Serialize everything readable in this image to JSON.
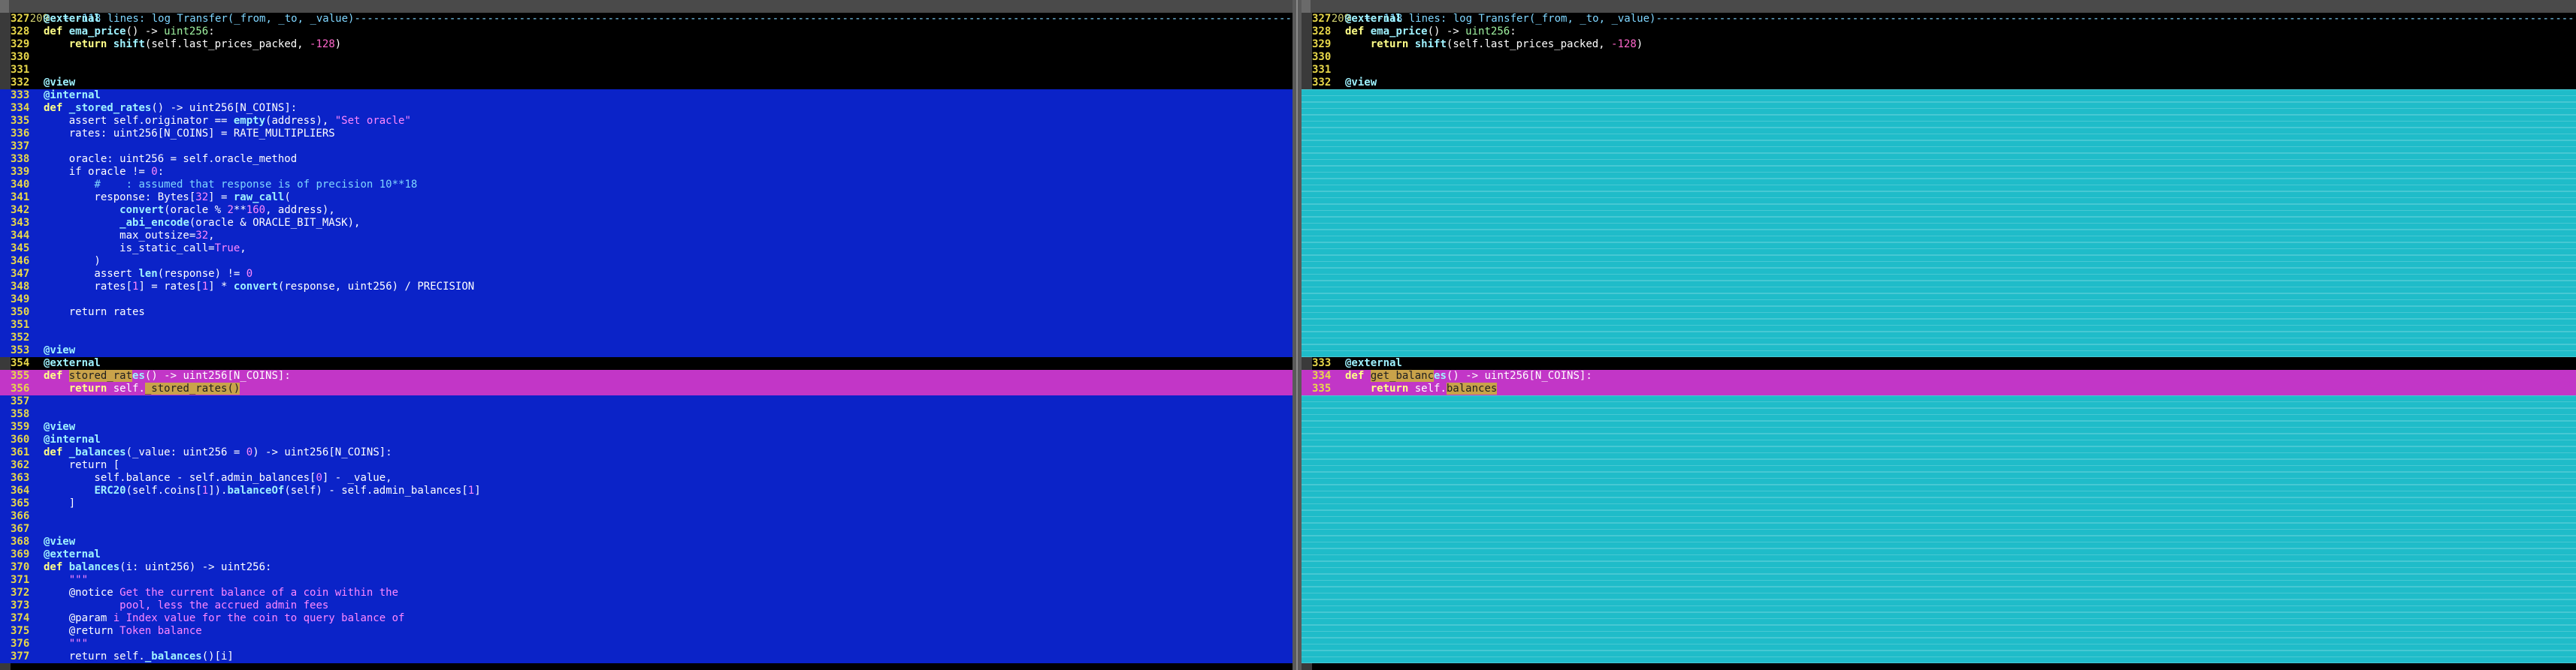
{
  "left": {
    "fold": {
      "gutter": "209",
      "text": "+--118 lines: log Transfer(_from, _to, _value)-----------------------------------------------------------------------------------------------------------------------------------------------------------------------------------------------------------"
    },
    "lines": [
      {
        "n": "327",
        "bg": "black",
        "html": "<span class='dec'>@external</span>"
      },
      {
        "n": "328",
        "bg": "black",
        "html": "<span class='kw'>def</span> <span class='fn'>ema_price</span>() -&gt; <span class='ty'>uint256</span>:"
      },
      {
        "n": "329",
        "bg": "black",
        "html": "    <span class='kw'>return</span> <span class='fn'>shift</span>(self.last_prices_packed, <span class='num'>-128</span>)"
      },
      {
        "n": "330",
        "bg": "black",
        "html": ""
      },
      {
        "n": "331",
        "bg": "black",
        "html": ""
      },
      {
        "n": "332",
        "bg": "black",
        "html": "<span class='dec'>@view</span>"
      },
      {
        "n": "333",
        "bg": "blue",
        "html": "<span class='dec'>@internal</span>"
      },
      {
        "n": "334",
        "bg": "blue",
        "html": "<span class='kw'>def</span> <span class='fn'>_stored_rates</span>() -&gt; uint256[N_COINS]:"
      },
      {
        "n": "335",
        "bg": "blue",
        "html": "    assert self.originator == <span class='fn'>empty</span>(address), <span class='str'>\"Set oracle\"</span>"
      },
      {
        "n": "336",
        "bg": "blue",
        "html": "    rates: uint256[N_COINS] = RATE_MULTIPLIERS"
      },
      {
        "n": "337",
        "bg": "blue",
        "html": ""
      },
      {
        "n": "338",
        "bg": "blue",
        "html": "    oracle: uint256 = self.oracle_method"
      },
      {
        "n": "339",
        "bg": "blue",
        "html": "    if oracle != <span class='num'>0</span>:"
      },
      {
        "n": "340",
        "bg": "blue",
        "html": "        <span class='cm'>#    : assumed that response is of precision 10**18</span>"
      },
      {
        "n": "341",
        "bg": "blue",
        "html": "        response: Bytes[<span class='num'>32</span>] = <span class='fn'>raw_call</span>("
      },
      {
        "n": "342",
        "bg": "blue",
        "html": "            <span class='fn'>convert</span>(oracle % <span class='num'>2</span>**<span class='num'>160</span>, address),"
      },
      {
        "n": "343",
        "bg": "blue",
        "html": "            <span class='fn'>_abi_encode</span>(oracle &amp; ORACLE_BIT_MASK),"
      },
      {
        "n": "344",
        "bg": "blue",
        "html": "            max_outsize=<span class='num'>32</span>,"
      },
      {
        "n": "345",
        "bg": "blue",
        "html": "            is_static_call=<span class='num'>True</span>,"
      },
      {
        "n": "346",
        "bg": "blue",
        "html": "        )"
      },
      {
        "n": "347",
        "bg": "blue",
        "html": "        assert <span class='fn'>len</span>(response) != <span class='num'>0</span>"
      },
      {
        "n": "348",
        "bg": "blue",
        "html": "        rates[<span class='num'>1</span>] = rates[<span class='num'>1</span>] * <span class='fn'>convert</span>(response, uint256) / PRECISION"
      },
      {
        "n": "349",
        "bg": "blue",
        "html": ""
      },
      {
        "n": "350",
        "bg": "blue",
        "html": "    return rates"
      },
      {
        "n": "351",
        "bg": "blue",
        "html": ""
      },
      {
        "n": "352",
        "bg": "blue",
        "html": ""
      },
      {
        "n": "353",
        "bg": "blue",
        "html": "<span class='dec'>@view</span>"
      },
      {
        "n": "354",
        "bg": "black",
        "html": "<span class='dec'>@external</span>"
      },
      {
        "n": "355",
        "bg": "mag",
        "html": "<span class='kw'>def</span> <span class='hl'>stored_rat</span><span class='fn'>es</span>() -&gt; uint256[N_COINS]:"
      },
      {
        "n": "356",
        "bg": "mag",
        "html": "    <span class='kw'>return</span> self.<span class='hl'>_stored_rates()</span>"
      },
      {
        "n": "357",
        "bg": "blue",
        "html": ""
      },
      {
        "n": "358",
        "bg": "blue",
        "html": ""
      },
      {
        "n": "359",
        "bg": "blue",
        "html": "<span class='dec'>@view</span>"
      },
      {
        "n": "360",
        "bg": "blue",
        "html": "<span class='dec'>@internal</span>"
      },
      {
        "n": "361",
        "bg": "blue",
        "html": "<span class='kw'>def</span> <span class='fn'>_balances</span>(_value: uint256 = <span class='num'>0</span>) -&gt; uint256[N_COINS]:"
      },
      {
        "n": "362",
        "bg": "blue",
        "html": "    return ["
      },
      {
        "n": "363",
        "bg": "blue",
        "html": "        self.balance - self.admin_balances[<span class='num'>0</span>] - _value,"
      },
      {
        "n": "364",
        "bg": "blue",
        "html": "        <span class='fn'>ERC20</span>(self.coins[<span class='num'>1</span>]).<span class='fn'>balanceOf</span>(self) - self.admin_balances[<span class='num'>1</span>]"
      },
      {
        "n": "365",
        "bg": "blue",
        "html": "    ]"
      },
      {
        "n": "366",
        "bg": "blue",
        "html": ""
      },
      {
        "n": "367",
        "bg": "blue",
        "html": ""
      },
      {
        "n": "368",
        "bg": "blue",
        "html": "<span class='dec'>@view</span>"
      },
      {
        "n": "369",
        "bg": "blue",
        "html": "<span class='dec'>@external</span>"
      },
      {
        "n": "370",
        "bg": "blue",
        "html": "<span class='kw'>def</span> <span class='fn'>balances</span>(i: uint256) -&gt; uint256:"
      },
      {
        "n": "371",
        "bg": "blue",
        "html": "    <span class='str'>\"\"\"</span>"
      },
      {
        "n": "372",
        "bg": "blue",
        "html": "    @notice <span class='str'>Get the current balance of a coin within the</span>"
      },
      {
        "n": "373",
        "bg": "blue",
        "html": "            <span class='str'>pool, less the accrued admin fees</span>"
      },
      {
        "n": "374",
        "bg": "blue",
        "html": "    @param <span class='str'>i Index value for the coin to query balance of</span>"
      },
      {
        "n": "375",
        "bg": "blue",
        "html": "    @return <span class='str'>Token balance</span>"
      },
      {
        "n": "376",
        "bg": "blue",
        "html": "    <span class='str'>\"\"\"</span>"
      },
      {
        "n": "377",
        "bg": "blue",
        "html": "    return self.<span class='fn'>_balances</span>()[i]"
      }
    ]
  },
  "right": {
    "fold": {
      "gutter": "209",
      "text": "+--118 lines: log Transfer(_from, _to, _value)-----------------------------------------------------------------------------------------------------------------------------------------------------------------------------------------------------------"
    },
    "lines": [
      {
        "n": "327",
        "bg": "black",
        "html": "<span class='dec'>@external</span>"
      },
      {
        "n": "328",
        "bg": "black",
        "html": "<span class='kw'>def</span> <span class='fn'>ema_price</span>() -&gt; <span class='ty'>uint256</span>:"
      },
      {
        "n": "329",
        "bg": "black",
        "html": "    <span class='kw'>return</span> <span class='fn'>shift</span>(self.last_prices_packed, <span class='num'>-128</span>)"
      },
      {
        "n": "330",
        "bg": "black",
        "html": ""
      },
      {
        "n": "331",
        "bg": "black",
        "html": ""
      },
      {
        "n": "332",
        "bg": "black",
        "html": "<span class='dec'>@view</span>"
      },
      {
        "n": "",
        "bg": "cyan",
        "html": ""
      },
      {
        "n": "",
        "bg": "cyan",
        "html": ""
      },
      {
        "n": "",
        "bg": "cyan",
        "html": ""
      },
      {
        "n": "",
        "bg": "cyan",
        "html": ""
      },
      {
        "n": "",
        "bg": "cyan",
        "html": ""
      },
      {
        "n": "",
        "bg": "cyan",
        "html": ""
      },
      {
        "n": "",
        "bg": "cyan",
        "html": ""
      },
      {
        "n": "",
        "bg": "cyan",
        "html": ""
      },
      {
        "n": "",
        "bg": "cyan",
        "html": ""
      },
      {
        "n": "",
        "bg": "cyan",
        "html": ""
      },
      {
        "n": "",
        "bg": "cyan",
        "html": ""
      },
      {
        "n": "",
        "bg": "cyan",
        "html": ""
      },
      {
        "n": "",
        "bg": "cyan",
        "html": ""
      },
      {
        "n": "",
        "bg": "cyan",
        "html": ""
      },
      {
        "n": "",
        "bg": "cyan",
        "html": ""
      },
      {
        "n": "",
        "bg": "cyan",
        "html": ""
      },
      {
        "n": "",
        "bg": "cyan",
        "html": ""
      },
      {
        "n": "",
        "bg": "cyan",
        "html": ""
      },
      {
        "n": "",
        "bg": "cyan",
        "html": ""
      },
      {
        "n": "",
        "bg": "cyan",
        "html": ""
      },
      {
        "n": "",
        "bg": "cyan",
        "html": ""
      },
      {
        "n": "333",
        "bg": "black",
        "html": "<span class='dec'>@external</span>"
      },
      {
        "n": "334",
        "bg": "mag",
        "html": "<span class='kw'>def</span> <span class='hl'>get_balanc</span><span class='fn'>es</span>() -&gt; uint256[N_COINS]:"
      },
      {
        "n": "335",
        "bg": "mag",
        "html": "    <span class='kw'>return</span> self.<span class='hl'>balances</span>"
      },
      {
        "n": "",
        "bg": "cyan",
        "html": ""
      },
      {
        "n": "",
        "bg": "cyan",
        "html": ""
      },
      {
        "n": "",
        "bg": "cyan",
        "html": ""
      },
      {
        "n": "",
        "bg": "cyan",
        "html": ""
      },
      {
        "n": "",
        "bg": "cyan",
        "html": ""
      },
      {
        "n": "",
        "bg": "cyan",
        "html": ""
      },
      {
        "n": "",
        "bg": "cyan",
        "html": ""
      },
      {
        "n": "",
        "bg": "cyan",
        "html": ""
      },
      {
        "n": "",
        "bg": "cyan",
        "html": ""
      },
      {
        "n": "",
        "bg": "cyan",
        "html": ""
      },
      {
        "n": "",
        "bg": "cyan",
        "html": ""
      },
      {
        "n": "",
        "bg": "cyan",
        "html": ""
      },
      {
        "n": "",
        "bg": "cyan",
        "html": ""
      },
      {
        "n": "",
        "bg": "cyan",
        "html": ""
      },
      {
        "n": "",
        "bg": "cyan",
        "html": ""
      },
      {
        "n": "",
        "bg": "cyan",
        "html": ""
      },
      {
        "n": "",
        "bg": "cyan",
        "html": ""
      },
      {
        "n": "",
        "bg": "cyan",
        "html": ""
      },
      {
        "n": "",
        "bg": "cyan",
        "html": ""
      },
      {
        "n": "",
        "bg": "cyan",
        "html": ""
      },
      {
        "n": "",
        "bg": "cyan",
        "html": ""
      }
    ]
  }
}
